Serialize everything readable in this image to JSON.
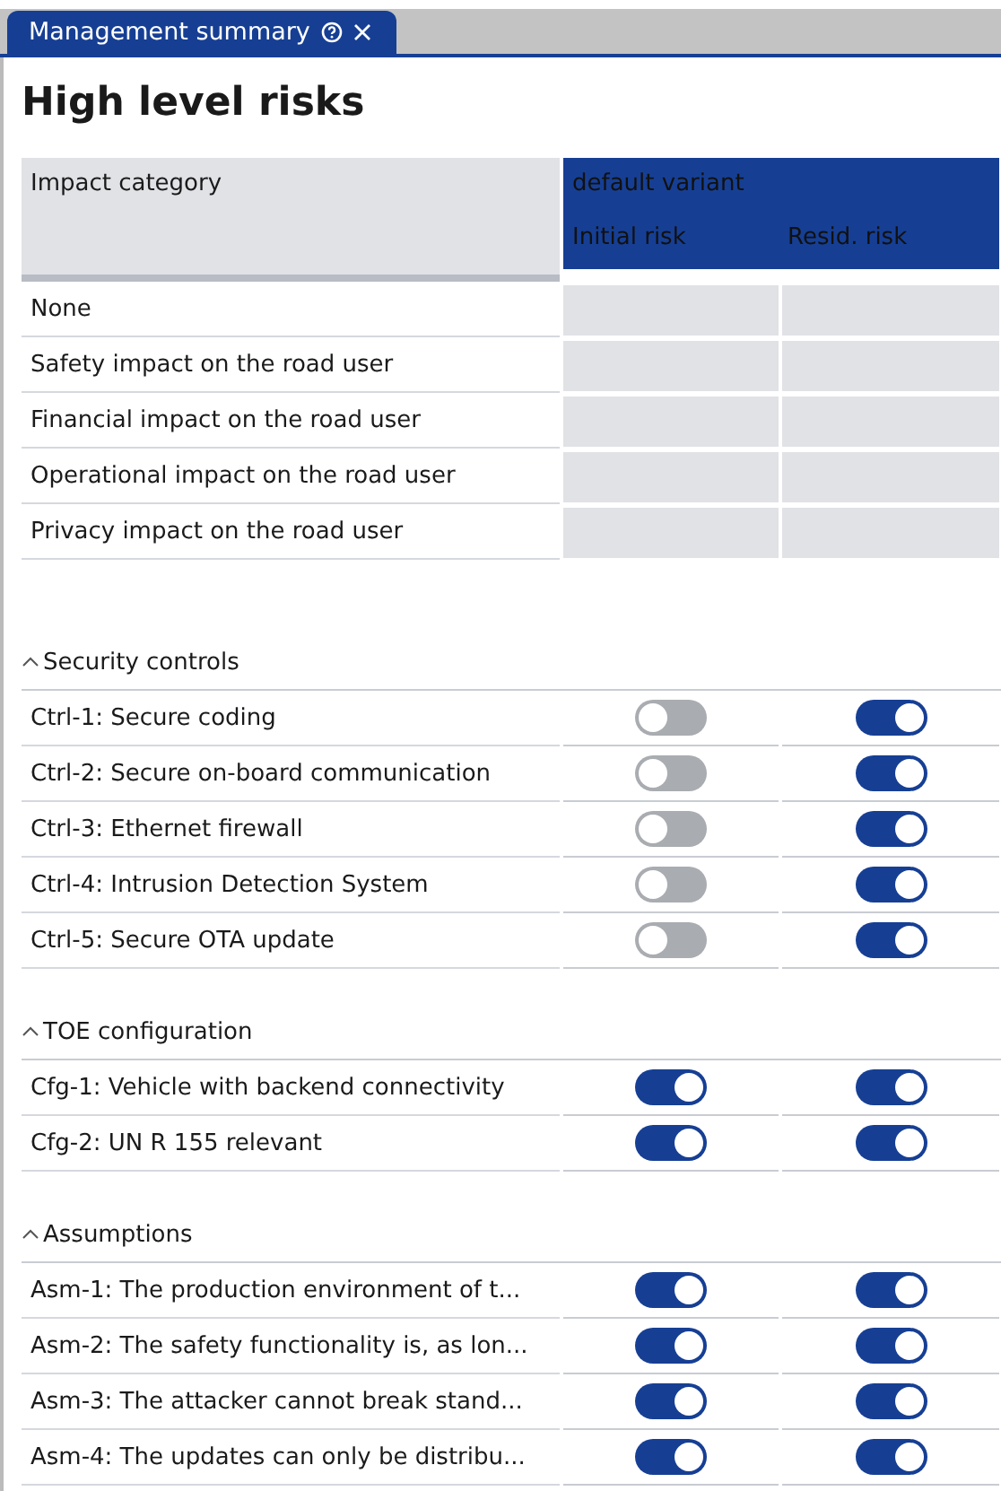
{
  "tab": {
    "title": "Management summary",
    "selected": true
  },
  "heading": "High level risks",
  "table": {
    "label_column": "Impact category",
    "variant": "default variant",
    "columns": [
      "Initial risk",
      "Resid. risk"
    ],
    "rows": [
      "None",
      "Safety impact on the road user",
      "Financial impact on the road user",
      "Operational impact on the road user",
      "Privacy impact on the road user"
    ]
  },
  "sections": [
    {
      "title": "Security controls",
      "expanded": true,
      "rows": [
        {
          "label": "Ctrl-1: Secure coding",
          "initial": false,
          "residual": true
        },
        {
          "label": "Ctrl-2: Secure on-board communication",
          "initial": false,
          "residual": true
        },
        {
          "label": "Ctrl-3: Ethernet firewall",
          "initial": false,
          "residual": true
        },
        {
          "label": "Ctrl-4: Intrusion Detection System",
          "initial": false,
          "residual": true
        },
        {
          "label": "Ctrl-5: Secure OTA update",
          "initial": false,
          "residual": true
        }
      ]
    },
    {
      "title": "TOE configuration",
      "expanded": true,
      "rows": [
        {
          "label": "Cfg-1: Vehicle with backend connectivity",
          "initial": true,
          "residual": true
        },
        {
          "label": "Cfg-2: UN R 155 relevant",
          "initial": true,
          "residual": true
        }
      ]
    },
    {
      "title": "Assumptions",
      "expanded": true,
      "rows": [
        {
          "label": "Asm-1: The production environment of t...",
          "initial": true,
          "residual": true
        },
        {
          "label": "Asm-2: The safety functionality is, as lon...",
          "initial": true,
          "residual": true
        },
        {
          "label": "Asm-3: The attacker cannot break stand...",
          "initial": true,
          "residual": true
        },
        {
          "label": "Asm-4: The updates can only be distribu...",
          "initial": true,
          "residual": true
        }
      ]
    }
  ]
}
